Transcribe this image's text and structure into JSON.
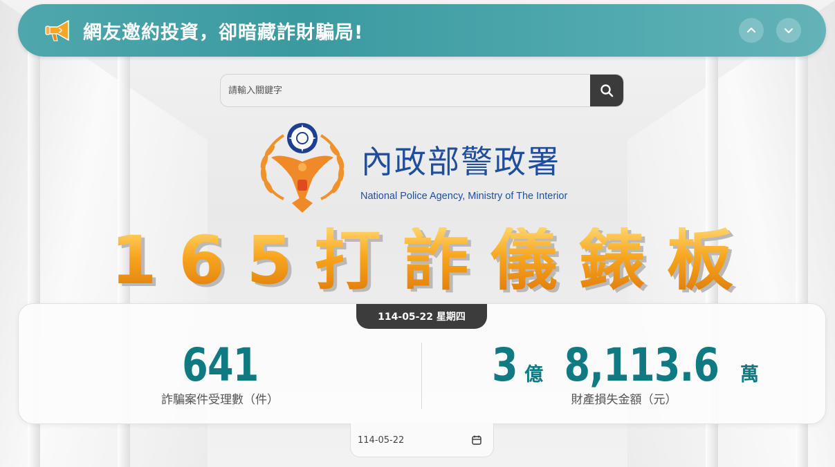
{
  "announcement": {
    "title": "網友邀約投資，卻暗藏詐財騙局!",
    "icon": "megaphone-icon",
    "prev_icon": "chevron-up-icon",
    "next_icon": "chevron-down-icon",
    "bar_color": "#3a9aa0"
  },
  "search": {
    "placeholder": "請輸入關鍵字",
    "button_icon": "search-icon"
  },
  "logo": {
    "org_zh": "內政部警政署",
    "org_en": "National Police Agency, Ministry of The Interior"
  },
  "banner": {
    "chars": [
      "1",
      "6",
      "5",
      "打",
      "詐",
      "儀",
      "錶",
      "板"
    ]
  },
  "stats": {
    "date_label": "114-05-22 星期四",
    "cases": {
      "value": "641",
      "label": "詐騙案件受理數（件）"
    },
    "loss": {
      "part1": "3",
      "unit1": "億",
      "part2": "8,113.6",
      "unit2": "萬",
      "label": "財產損失金額（元）"
    }
  },
  "datepicker": {
    "value": "114-05-22",
    "icon": "calendar-icon"
  },
  "colors": {
    "accent": "#0f7a82",
    "brand_blue": "#1f4f9c",
    "orange": "#f29a1a"
  }
}
